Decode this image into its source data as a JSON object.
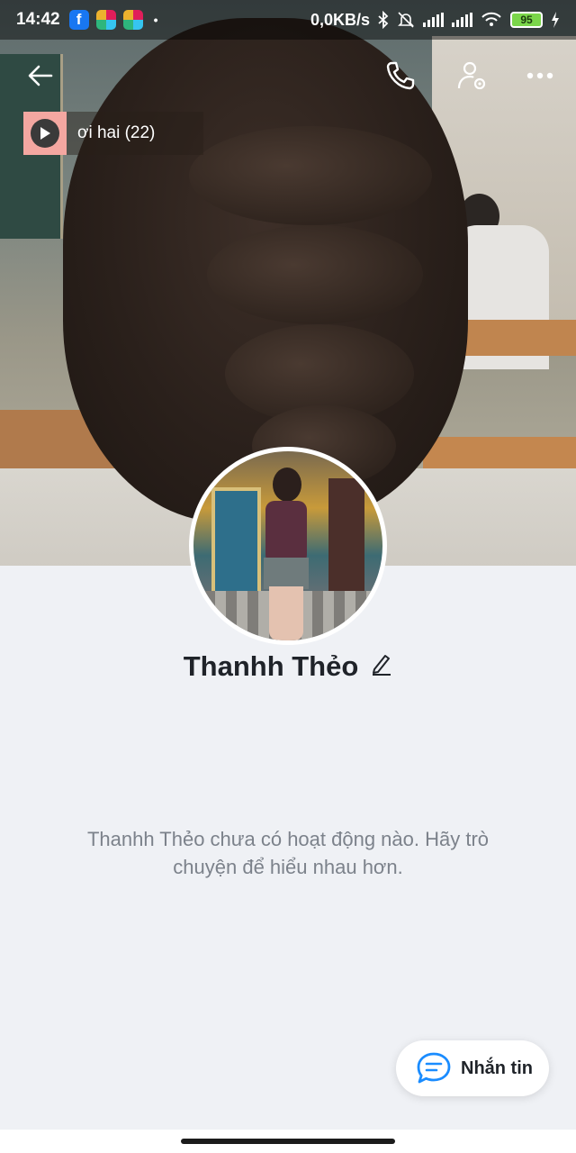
{
  "status_bar": {
    "time": "14:42",
    "net_speed": "0,0KB/s",
    "battery": "95",
    "icons": [
      "facebook-icon",
      "slack-icon",
      "slack-icon",
      "bluetooth-icon",
      "mute-icon",
      "signal-icon",
      "signal-icon",
      "wifi-icon",
      "charging-icon"
    ]
  },
  "top_bar": {
    "back_icon": "arrow-left-icon",
    "call_icon": "phone-icon",
    "settings_icon": "user-settings-icon",
    "more_icon": "more-dots-icon"
  },
  "music": {
    "title": "ơi hai (22)",
    "play_icon": "play-icon"
  },
  "profile": {
    "name": "Thanhh Thẻo",
    "edit_icon": "pencil-icon"
  },
  "empty_state": {
    "message": "Thanhh Thẻo chưa có hoạt động nào. Hãy trò chuyện để hiểu nhau hơn."
  },
  "message_button": {
    "label": "Nhắn tin",
    "icon": "chat-bubble-icon"
  }
}
